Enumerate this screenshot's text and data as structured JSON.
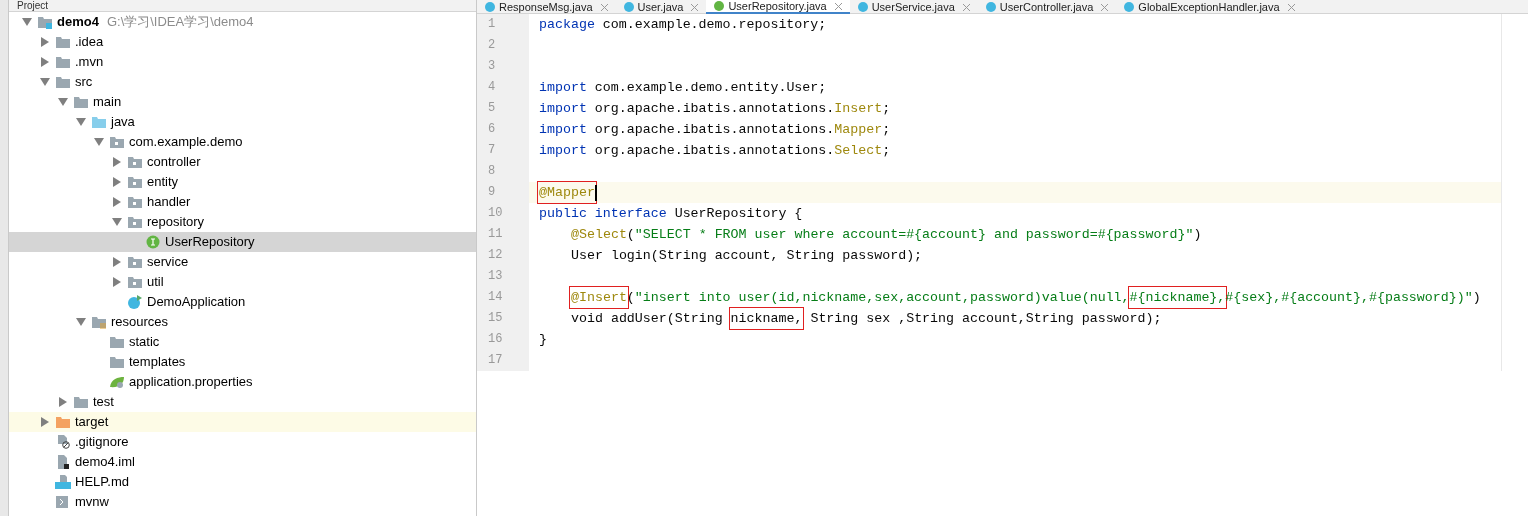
{
  "project_panel": {
    "title": "Project",
    "tree": [
      {
        "label": "demo4",
        "path": "G:\\学习\\IDEA学习\\demo4",
        "kind": "module",
        "expanded": true,
        "selected": false,
        "children": [
          {
            "label": ".idea",
            "kind": "folder",
            "expanded": false,
            "selected": false
          },
          {
            "label": ".mvn",
            "kind": "folder",
            "expanded": false,
            "selected": false
          },
          {
            "label": "src",
            "kind": "folder",
            "expanded": true,
            "selected": false,
            "children": [
              {
                "label": "main",
                "kind": "folder",
                "expanded": true,
                "selected": false,
                "children": [
                  {
                    "label": "java",
                    "kind": "source",
                    "expanded": true,
                    "selected": false,
                    "children": [
                      {
                        "label": "com.example.demo",
                        "kind": "package",
                        "expanded": true,
                        "selected": false,
                        "children": [
                          {
                            "label": "controller",
                            "kind": "package",
                            "expanded": false,
                            "selected": false
                          },
                          {
                            "label": "entity",
                            "kind": "package",
                            "expanded": false,
                            "selected": false
                          },
                          {
                            "label": "handler",
                            "kind": "package",
                            "expanded": false,
                            "selected": false
                          },
                          {
                            "label": "repository",
                            "kind": "package",
                            "expanded": true,
                            "selected": false,
                            "children": [
                              {
                                "label": "UserRepository",
                                "kind": "interface",
                                "selected": true
                              }
                            ]
                          },
                          {
                            "label": "service",
                            "kind": "package",
                            "expanded": false,
                            "selected": false
                          },
                          {
                            "label": "util",
                            "kind": "package",
                            "expanded": false,
                            "selected": false
                          },
                          {
                            "label": "DemoApplication",
                            "kind": "app",
                            "selected": false
                          }
                        ]
                      }
                    ]
                  },
                  {
                    "label": "resources",
                    "kind": "resources",
                    "expanded": true,
                    "selected": false,
                    "children": [
                      {
                        "label": "static",
                        "kind": "plainfolder",
                        "selected": false
                      },
                      {
                        "label": "templates",
                        "kind": "plainfolder",
                        "selected": false
                      },
                      {
                        "label": "application.properties",
                        "kind": "properties",
                        "selected": false
                      }
                    ]
                  }
                ]
              },
              {
                "label": "test",
                "kind": "folder",
                "expanded": false,
                "selected": false
              }
            ]
          },
          {
            "label": "target",
            "kind": "excluded",
            "expanded": false,
            "selected": false,
            "highlighted": true
          },
          {
            "label": ".gitignore",
            "kind": "ignore",
            "selected": false
          },
          {
            "label": "demo4.iml",
            "kind": "iml",
            "selected": false
          },
          {
            "label": "HELP.md",
            "kind": "md",
            "selected": false
          },
          {
            "label": "mvnw",
            "kind": "script",
            "selected": false
          }
        ]
      }
    ]
  },
  "editor_tabs": [
    {
      "label": "ResponseMsg.java",
      "kind": "class",
      "selected": false
    },
    {
      "label": "User.java",
      "kind": "class",
      "selected": false
    },
    {
      "label": "UserRepository.java",
      "kind": "interface",
      "selected": true
    },
    {
      "label": "UserService.java",
      "kind": "class",
      "selected": false
    },
    {
      "label": "UserController.java",
      "kind": "class",
      "selected": false
    },
    {
      "label": "GlobalExceptionHandler.java",
      "kind": "class",
      "selected": false
    }
  ],
  "code_lines": [
    {
      "number": "1",
      "current": false,
      "indented": false,
      "tokens": [
        {
          "text": "package",
          "kind": "keyword"
        },
        {
          "text": " com.example.demo.repository;",
          "kind": "plain"
        }
      ]
    },
    {
      "number": "2",
      "current": false
    },
    {
      "number": "3",
      "current": false
    },
    {
      "number": "4",
      "current": false,
      "indented": false,
      "tokens": [
        {
          "text": "import",
          "kind": "keyword"
        },
        {
          "text": " com.example.demo.entity.User;",
          "kind": "plain"
        }
      ]
    },
    {
      "number": "5",
      "current": false,
      "indented": false,
      "tokens": [
        {
          "text": "import",
          "kind": "keyword"
        },
        {
          "text": " org.apache.ibatis.annotations.",
          "kind": "plain"
        },
        {
          "text": "Insert",
          "kind": "annotation"
        },
        {
          "text": ";",
          "kind": "plain"
        }
      ]
    },
    {
      "number": "6",
      "current": false,
      "indented": false,
      "tokens": [
        {
          "text": "import",
          "kind": "keyword"
        },
        {
          "text": " org.apache.ibatis.annotations.",
          "kind": "plain"
        },
        {
          "text": "Mapper",
          "kind": "annotation"
        },
        {
          "text": ";",
          "kind": "plain"
        }
      ]
    },
    {
      "number": "7",
      "current": false,
      "indented": false,
      "tokens": [
        {
          "text": "import",
          "kind": "keyword"
        },
        {
          "text": " org.apache.ibatis.annotations.",
          "kind": "plain"
        },
        {
          "text": "Select",
          "kind": "annotation"
        },
        {
          "text": ";",
          "kind": "plain"
        }
      ]
    },
    {
      "number": "8",
      "current": false
    },
    {
      "number": "9",
      "current": true,
      "indented": false,
      "tokens": [
        {
          "text": "@Mapper",
          "kind": "annotation",
          "boxed": true
        }
      ]
    },
    {
      "number": "10",
      "current": false,
      "indented": false,
      "tokens": [
        {
          "text": "public interface",
          "kind": "keyword"
        },
        {
          "text": " UserRepository {",
          "kind": "plain"
        }
      ]
    },
    {
      "number": "11",
      "current": false,
      "indented": true,
      "tokens": [
        {
          "text": "@Select",
          "kind": "annotation"
        },
        {
          "text": "(",
          "kind": "plain"
        },
        {
          "text": "\"SELECT * FROM user where account=#{account} and password=#{password}\"",
          "kind": "string"
        },
        {
          "text": ")",
          "kind": "plain"
        }
      ]
    },
    {
      "number": "12",
      "current": false,
      "indented": true,
      "tokens": [
        {
          "text": "User login(String account, String password);",
          "kind": "plain"
        }
      ]
    },
    {
      "number": "13",
      "current": false
    },
    {
      "number": "14",
      "current": false,
      "indented": true,
      "tokens": [
        {
          "text": "@Insert",
          "kind": "annotation",
          "boxed": true
        },
        {
          "text": "(",
          "kind": "plain"
        },
        {
          "text": "\"insert into user(id,nickname,sex,account,password)value(null,",
          "kind": "string"
        },
        {
          "text": "#{nickname},",
          "kind": "string",
          "boxed": true
        },
        {
          "text": "#{sex},#{account},#{password})\"",
          "kind": "string"
        },
        {
          "text": ")",
          "kind": "plain"
        }
      ]
    },
    {
      "number": "15",
      "current": false,
      "indented": true,
      "tokens": [
        {
          "text": "void addUser(String ",
          "kind": "plain"
        },
        {
          "text": "nickname,",
          "kind": "plain",
          "boxed": true
        },
        {
          "text": " String sex ,String account,String password);",
          "kind": "plain"
        }
      ]
    },
    {
      "number": "16",
      "current": false,
      "indented": false,
      "tokens": [
        {
          "text": "}",
          "kind": "plain"
        }
      ]
    },
    {
      "number": "17",
      "current": false
    }
  ]
}
